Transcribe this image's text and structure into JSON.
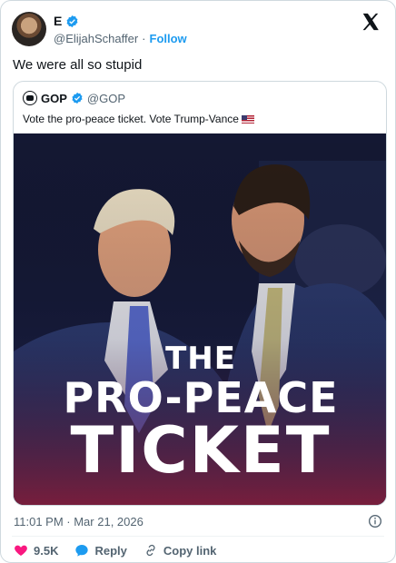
{
  "author": {
    "name": "E",
    "handle": "@ElijahSchaffer",
    "separator": "·",
    "follow_label": "Follow"
  },
  "tweet": {
    "text": "We were all so stupid"
  },
  "quote": {
    "name": "GOP",
    "handle": "@GOP",
    "text": "Vote the pro-peace ticket. Vote Trump-Vance",
    "image": {
      "line1": "THE",
      "line2": "PRO-PEACE",
      "line3": "TICKET"
    }
  },
  "meta": {
    "timestamp": "11:01 PM · Mar 21, 2026"
  },
  "actions": {
    "likes": "9.5K",
    "reply": "Reply",
    "copy": "Copy link"
  },
  "colors": {
    "accent": "#1d9bf0",
    "like": "#f91880",
    "text": "#0f1419",
    "muted": "#536471"
  },
  "icons": [
    "verified-badge-icon",
    "x-logo-icon",
    "info-icon",
    "heart-icon",
    "reply-bubble-icon",
    "link-icon",
    "us-flag-icon"
  ]
}
